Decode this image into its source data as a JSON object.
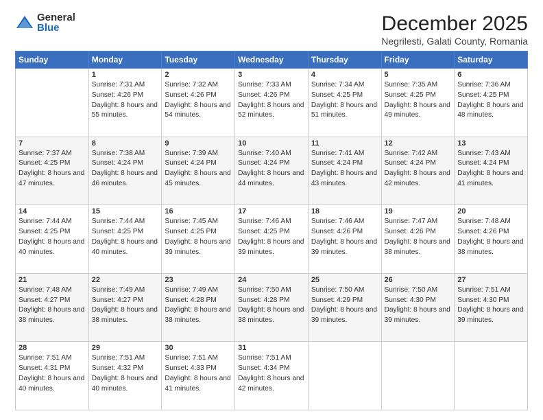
{
  "logo": {
    "general": "General",
    "blue": "Blue"
  },
  "title": "December 2025",
  "subtitle": "Negrilesti, Galati County, Romania",
  "weekdays": [
    "Sunday",
    "Monday",
    "Tuesday",
    "Wednesday",
    "Thursday",
    "Friday",
    "Saturday"
  ],
  "weeks": [
    [
      {
        "day": "",
        "sunrise": "",
        "sunset": "",
        "daylight": ""
      },
      {
        "day": "1",
        "sunrise": "Sunrise: 7:31 AM",
        "sunset": "Sunset: 4:26 PM",
        "daylight": "Daylight: 8 hours and 55 minutes."
      },
      {
        "day": "2",
        "sunrise": "Sunrise: 7:32 AM",
        "sunset": "Sunset: 4:26 PM",
        "daylight": "Daylight: 8 hours and 54 minutes."
      },
      {
        "day": "3",
        "sunrise": "Sunrise: 7:33 AM",
        "sunset": "Sunset: 4:26 PM",
        "daylight": "Daylight: 8 hours and 52 minutes."
      },
      {
        "day": "4",
        "sunrise": "Sunrise: 7:34 AM",
        "sunset": "Sunset: 4:25 PM",
        "daylight": "Daylight: 8 hours and 51 minutes."
      },
      {
        "day": "5",
        "sunrise": "Sunrise: 7:35 AM",
        "sunset": "Sunset: 4:25 PM",
        "daylight": "Daylight: 8 hours and 49 minutes."
      },
      {
        "day": "6",
        "sunrise": "Sunrise: 7:36 AM",
        "sunset": "Sunset: 4:25 PM",
        "daylight": "Daylight: 8 hours and 48 minutes."
      }
    ],
    [
      {
        "day": "7",
        "sunrise": "Sunrise: 7:37 AM",
        "sunset": "Sunset: 4:25 PM",
        "daylight": "Daylight: 8 hours and 47 minutes."
      },
      {
        "day": "8",
        "sunrise": "Sunrise: 7:38 AM",
        "sunset": "Sunset: 4:24 PM",
        "daylight": "Daylight: 8 hours and 46 minutes."
      },
      {
        "day": "9",
        "sunrise": "Sunrise: 7:39 AM",
        "sunset": "Sunset: 4:24 PM",
        "daylight": "Daylight: 8 hours and 45 minutes."
      },
      {
        "day": "10",
        "sunrise": "Sunrise: 7:40 AM",
        "sunset": "Sunset: 4:24 PM",
        "daylight": "Daylight: 8 hours and 44 minutes."
      },
      {
        "day": "11",
        "sunrise": "Sunrise: 7:41 AM",
        "sunset": "Sunset: 4:24 PM",
        "daylight": "Daylight: 8 hours and 43 minutes."
      },
      {
        "day": "12",
        "sunrise": "Sunrise: 7:42 AM",
        "sunset": "Sunset: 4:24 PM",
        "daylight": "Daylight: 8 hours and 42 minutes."
      },
      {
        "day": "13",
        "sunrise": "Sunrise: 7:43 AM",
        "sunset": "Sunset: 4:24 PM",
        "daylight": "Daylight: 8 hours and 41 minutes."
      }
    ],
    [
      {
        "day": "14",
        "sunrise": "Sunrise: 7:44 AM",
        "sunset": "Sunset: 4:25 PM",
        "daylight": "Daylight: 8 hours and 40 minutes."
      },
      {
        "day": "15",
        "sunrise": "Sunrise: 7:44 AM",
        "sunset": "Sunset: 4:25 PM",
        "daylight": "Daylight: 8 hours and 40 minutes."
      },
      {
        "day": "16",
        "sunrise": "Sunrise: 7:45 AM",
        "sunset": "Sunset: 4:25 PM",
        "daylight": "Daylight: 8 hours and 39 minutes."
      },
      {
        "day": "17",
        "sunrise": "Sunrise: 7:46 AM",
        "sunset": "Sunset: 4:25 PM",
        "daylight": "Daylight: 8 hours and 39 minutes."
      },
      {
        "day": "18",
        "sunrise": "Sunrise: 7:46 AM",
        "sunset": "Sunset: 4:26 PM",
        "daylight": "Daylight: 8 hours and 39 minutes."
      },
      {
        "day": "19",
        "sunrise": "Sunrise: 7:47 AM",
        "sunset": "Sunset: 4:26 PM",
        "daylight": "Daylight: 8 hours and 38 minutes."
      },
      {
        "day": "20",
        "sunrise": "Sunrise: 7:48 AM",
        "sunset": "Sunset: 4:26 PM",
        "daylight": "Daylight: 8 hours and 38 minutes."
      }
    ],
    [
      {
        "day": "21",
        "sunrise": "Sunrise: 7:48 AM",
        "sunset": "Sunset: 4:27 PM",
        "daylight": "Daylight: 8 hours and 38 minutes."
      },
      {
        "day": "22",
        "sunrise": "Sunrise: 7:49 AM",
        "sunset": "Sunset: 4:27 PM",
        "daylight": "Daylight: 8 hours and 38 minutes."
      },
      {
        "day": "23",
        "sunrise": "Sunrise: 7:49 AM",
        "sunset": "Sunset: 4:28 PM",
        "daylight": "Daylight: 8 hours and 38 minutes."
      },
      {
        "day": "24",
        "sunrise": "Sunrise: 7:50 AM",
        "sunset": "Sunset: 4:28 PM",
        "daylight": "Daylight: 8 hours and 38 minutes."
      },
      {
        "day": "25",
        "sunrise": "Sunrise: 7:50 AM",
        "sunset": "Sunset: 4:29 PM",
        "daylight": "Daylight: 8 hours and 39 minutes."
      },
      {
        "day": "26",
        "sunrise": "Sunrise: 7:50 AM",
        "sunset": "Sunset: 4:30 PM",
        "daylight": "Daylight: 8 hours and 39 minutes."
      },
      {
        "day": "27",
        "sunrise": "Sunrise: 7:51 AM",
        "sunset": "Sunset: 4:30 PM",
        "daylight": "Daylight: 8 hours and 39 minutes."
      }
    ],
    [
      {
        "day": "28",
        "sunrise": "Sunrise: 7:51 AM",
        "sunset": "Sunset: 4:31 PM",
        "daylight": "Daylight: 8 hours and 40 minutes."
      },
      {
        "day": "29",
        "sunrise": "Sunrise: 7:51 AM",
        "sunset": "Sunset: 4:32 PM",
        "daylight": "Daylight: 8 hours and 40 minutes."
      },
      {
        "day": "30",
        "sunrise": "Sunrise: 7:51 AM",
        "sunset": "Sunset: 4:33 PM",
        "daylight": "Daylight: 8 hours and 41 minutes."
      },
      {
        "day": "31",
        "sunrise": "Sunrise: 7:51 AM",
        "sunset": "Sunset: 4:34 PM",
        "daylight": "Daylight: 8 hours and 42 minutes."
      },
      {
        "day": "",
        "sunrise": "",
        "sunset": "",
        "daylight": ""
      },
      {
        "day": "",
        "sunrise": "",
        "sunset": "",
        "daylight": ""
      },
      {
        "day": "",
        "sunrise": "",
        "sunset": "",
        "daylight": ""
      }
    ]
  ]
}
